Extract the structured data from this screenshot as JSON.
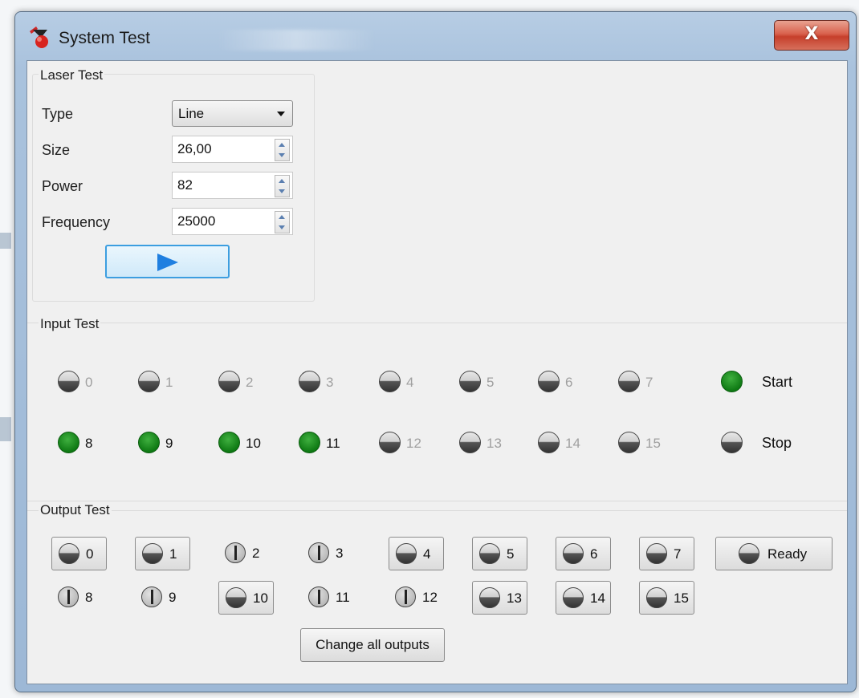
{
  "window": {
    "title": "System Test",
    "close_glyph": "X"
  },
  "laser_test": {
    "title": "Laser Test",
    "fields": [
      {
        "label": "Type",
        "value": "Line",
        "kind": "combo"
      },
      {
        "label": "Size",
        "value": "26,00",
        "kind": "spin"
      },
      {
        "label": "Power",
        "value": "82",
        "kind": "spin"
      },
      {
        "label": "Frequency",
        "value": "25000",
        "kind": "spin"
      }
    ],
    "run_icon": "play-icon"
  },
  "input_test": {
    "title": "Input Test",
    "inputs": [
      {
        "num": "0",
        "on": false
      },
      {
        "num": "1",
        "on": false
      },
      {
        "num": "2",
        "on": false
      },
      {
        "num": "3",
        "on": false
      },
      {
        "num": "4",
        "on": false
      },
      {
        "num": "5",
        "on": false
      },
      {
        "num": "6",
        "on": false
      },
      {
        "num": "7",
        "on": false
      },
      {
        "num": "8",
        "on": true
      },
      {
        "num": "9",
        "on": true
      },
      {
        "num": "10",
        "on": true
      },
      {
        "num": "11",
        "on": true
      },
      {
        "num": "12",
        "on": false
      },
      {
        "num": "13",
        "on": false
      },
      {
        "num": "14",
        "on": false
      },
      {
        "num": "15",
        "on": false
      }
    ],
    "start": {
      "label": "Start",
      "on": true
    },
    "stop": {
      "label": "Stop",
      "on": false
    },
    "colors": {
      "on": "#1a8a1f",
      "off_number": "#a0a0a0"
    }
  },
  "output_test": {
    "title": "Output Test",
    "outputs": [
      {
        "num": "0",
        "style": "button"
      },
      {
        "num": "1",
        "style": "button"
      },
      {
        "num": "2",
        "style": "flat"
      },
      {
        "num": "3",
        "style": "flat"
      },
      {
        "num": "4",
        "style": "button"
      },
      {
        "num": "5",
        "style": "button"
      },
      {
        "num": "6",
        "style": "button"
      },
      {
        "num": "7",
        "style": "button"
      },
      {
        "num": "8",
        "style": "flat"
      },
      {
        "num": "9",
        "style": "flat"
      },
      {
        "num": "10",
        "style": "button"
      },
      {
        "num": "11",
        "style": "flat"
      },
      {
        "num": "12",
        "style": "flat"
      },
      {
        "num": "13",
        "style": "button"
      },
      {
        "num": "14",
        "style": "button"
      },
      {
        "num": "15",
        "style": "button"
      }
    ],
    "ready": {
      "label": "Ready"
    },
    "change_all": "Change all outputs"
  }
}
